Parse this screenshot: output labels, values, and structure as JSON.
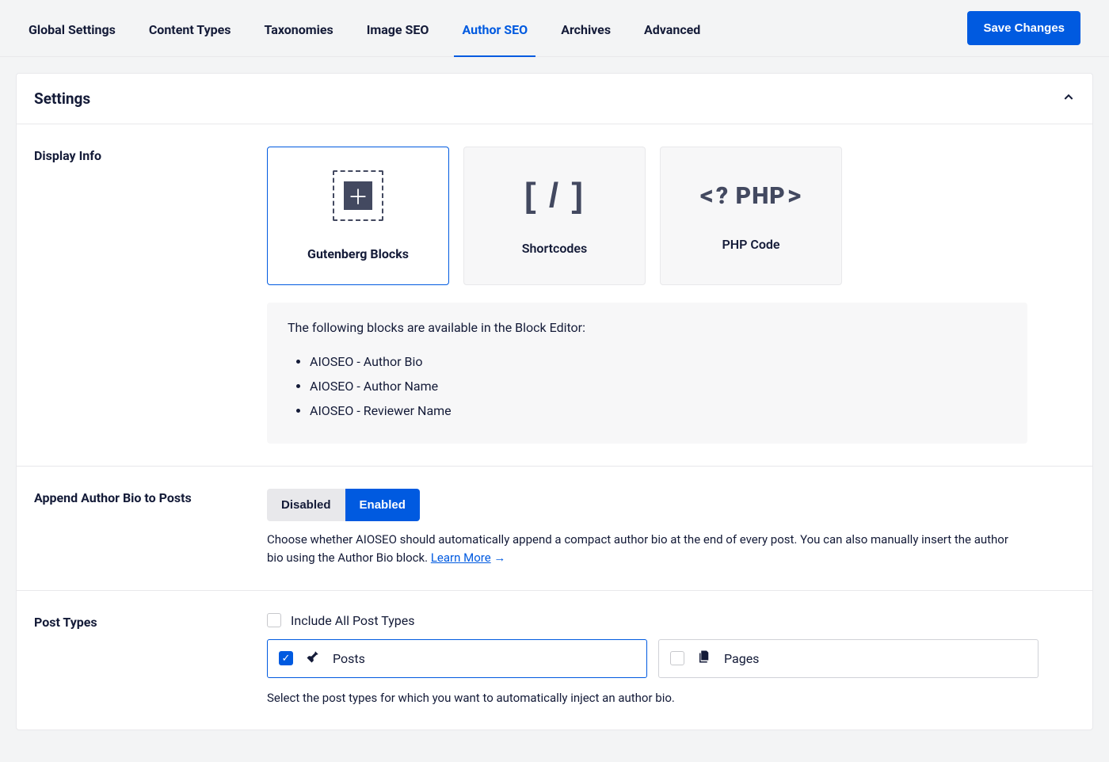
{
  "tabs": {
    "items": [
      {
        "label": "Global Settings"
      },
      {
        "label": "Content Types"
      },
      {
        "label": "Taxonomies"
      },
      {
        "label": "Image SEO"
      },
      {
        "label": "Author SEO"
      },
      {
        "label": "Archives"
      },
      {
        "label": "Advanced"
      }
    ],
    "active_index": 4
  },
  "save_button": "Save Changes",
  "panel": {
    "title": "Settings"
  },
  "display_info": {
    "label": "Display Info",
    "options": [
      {
        "title": "Gutenberg Blocks"
      },
      {
        "title": "Shortcodes"
      },
      {
        "title": "PHP Code"
      }
    ],
    "selected_index": 0,
    "block_list_intro": "The following blocks are available in the Block Editor:",
    "block_list": [
      "AIOSEO - Author Bio",
      "AIOSEO - Author Name",
      "AIOSEO - Reviewer Name"
    ]
  },
  "append_bio": {
    "label": "Append Author Bio to Posts",
    "disabled_label": "Disabled",
    "enabled_label": "Enabled",
    "state": "enabled",
    "help": "Choose whether AIOSEO should automatically append a compact author bio at the end of every post. You can also manually insert the author bio using the Author Bio block.",
    "learn_more": "Learn More"
  },
  "post_types": {
    "label": "Post Types",
    "include_all_label": "Include All Post Types",
    "items": [
      {
        "name": "Posts",
        "checked": true
      },
      {
        "name": "Pages",
        "checked": false
      }
    ],
    "help": "Select the post types for which you want to automatically inject an author bio."
  }
}
